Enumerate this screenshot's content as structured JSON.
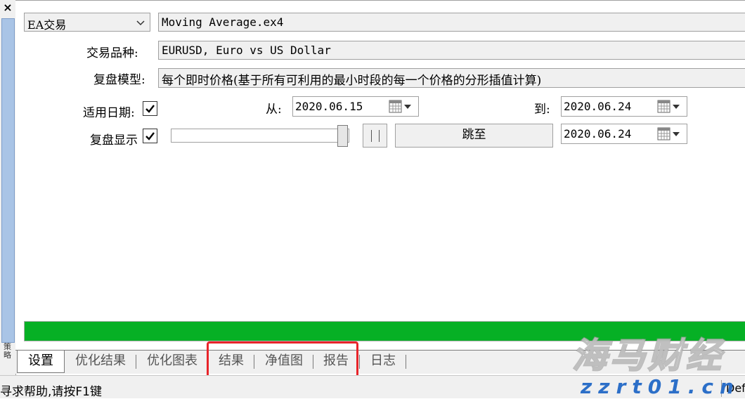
{
  "window": {
    "close_glyph": "×",
    "side_label": "策略"
  },
  "settings": {
    "ea_type": "EA交易",
    "expert_file": "Moving Average.ex4",
    "symbol_label": "交易品种:",
    "symbol_value": "EURUSD, Euro vs US Dollar",
    "model_label": "复盘模型:",
    "model_value": "每个即时价格(基于所有可利用的最小时段的每一个价格的分形插值计算)",
    "use_date_label": "适用日期:",
    "use_date_checked": true,
    "from_label": "从:",
    "from_date": "2020.06.15",
    "to_label": "到:",
    "to_date": "2020.06.24",
    "visual_label": "复盘显示",
    "visual_checked": true,
    "slider_level": 0.96,
    "jump_label": "跳至",
    "jump_date": "2020.06.24",
    "progress": 1.0
  },
  "tabs": [
    {
      "label": "设置",
      "active": true
    },
    {
      "label": "优化结果",
      "active": false
    },
    {
      "label": "优化图表",
      "active": false
    },
    {
      "label": "结果",
      "active": false
    },
    {
      "label": "净值图",
      "active": false
    },
    {
      "label": "报告",
      "active": false
    },
    {
      "label": "日志",
      "active": false
    }
  ],
  "status": {
    "help_text": "寻求帮助,请按F1键",
    "profile": "Def"
  },
  "watermark": {
    "brand": "海马财经",
    "url": "zzrt01.cn"
  },
  "colors": {
    "progress_fill": "#06b025",
    "highlight": "#e8242a",
    "sidebar": "#a9c4e6"
  },
  "icons": [
    "close-icon",
    "chevron-down-icon",
    "calendar-icon",
    "checkmark-icon",
    "pause-icon"
  ]
}
